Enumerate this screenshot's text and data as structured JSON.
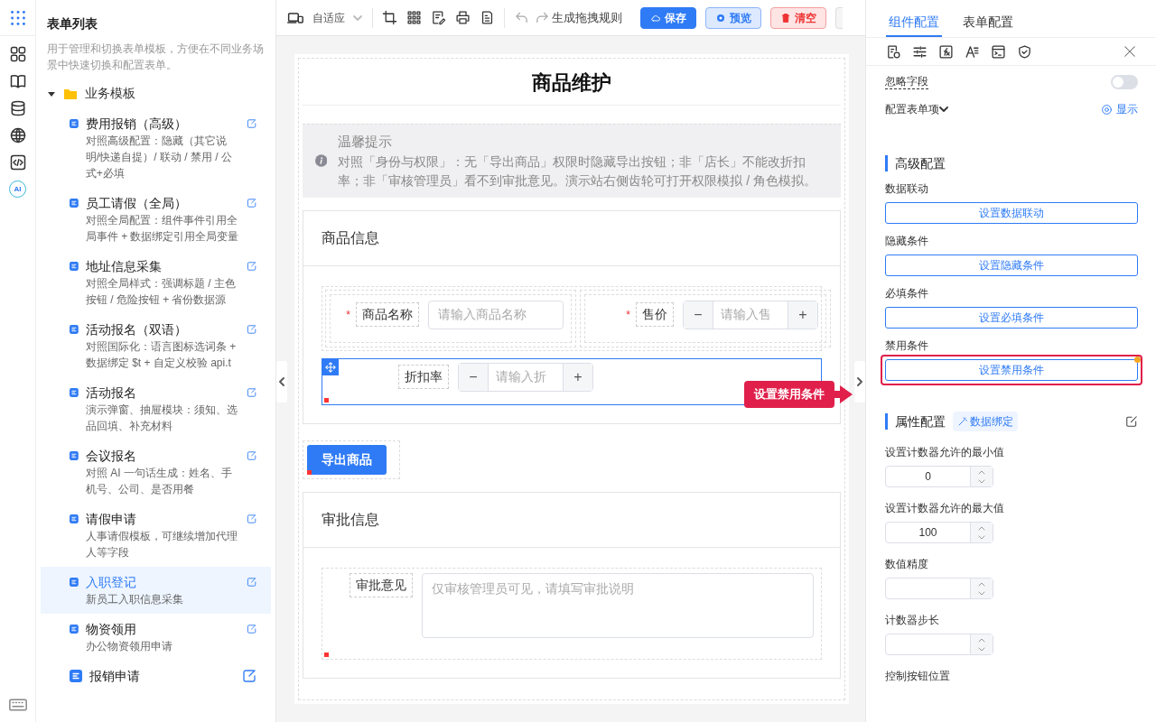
{
  "rail": {
    "ai_label": "AI"
  },
  "sidebar": {
    "title": "表单列表",
    "description": "用于管理和切换表单模板，方便在不同业务场景中快速切换和配置表单。",
    "folder": {
      "label": "业务模板",
      "expanded": true,
      "items": [
        {
          "title": "费用报销（高级）",
          "desc": "对照高级配置：隐藏（其它说明/快递自提）/ 联动 / 禁用 / 公式+必填",
          "selected": false
        },
        {
          "title": "员工请假（全局）",
          "desc": "对照全局配置：组件事件引用全局事件 + 数据绑定引用全局变量",
          "selected": false
        },
        {
          "title": "地址信息采集",
          "desc": "对照全局样式：强调标题 / 主色按钮 / 危险按钮 + 省份数据源",
          "selected": false
        },
        {
          "title": "活动报名（双语）",
          "desc": "对照国际化：语言图标选词条 + 数据绑定 $t + 自定义校验 api.t",
          "selected": false
        },
        {
          "title": "活动报名",
          "desc": "演示弹窗、抽屉模块：须知、选品回填、补充材料",
          "selected": false
        },
        {
          "title": "会议报名",
          "desc": "对照 AI 一句话生成：姓名、手机号、公司、是否用餐",
          "selected": false
        },
        {
          "title": "请假申请",
          "desc": "人事请假模板，可继续增加代理人等字段",
          "selected": false
        },
        {
          "title": "入职登记",
          "desc": "新员工入职信息采集",
          "selected": true
        },
        {
          "title": "物资领用",
          "desc": "办公物资领用申请",
          "selected": false
        },
        {
          "title": "报销申请",
          "selected": false
        }
      ]
    }
  },
  "toolbar": {
    "device": "自适应",
    "rule_link": "生成拖拽规则",
    "buttons": [
      {
        "kind": "save",
        "label": "保存"
      },
      {
        "kind": "preview",
        "label": "预览"
      },
      {
        "kind": "clear",
        "label": "清空"
      }
    ]
  },
  "form": {
    "title": "商品维护",
    "notice": {
      "title": "温馨提示",
      "text": "对照「身份与权限」：无「导出商品」权限时隐藏导出按钮；非「店长」不能改折扣率；非「审核管理员」看不到审批意见。演示站右侧齿轮可打开权限模拟 / 角色模拟。"
    },
    "blocks": [
      {
        "kind": "card",
        "title": "商品信息",
        "rows": [
          [
            {
              "kind": "input",
              "required_mark": "*",
              "label": "商品名称",
              "placeholder": "请输入商品名称",
              "selected": false
            },
            {
              "kind": "stepper",
              "required_mark": "*",
              "label": "售价",
              "minus": "−",
              "placeholder": "请输入售",
              "plus": "+",
              "selected": false
            }
          ],
          [
            {
              "kind": "stepper",
              "label": "折扣率",
              "minus": "−",
              "placeholder": "请输入折",
              "plus": "+",
              "selected": true
            }
          ]
        ]
      },
      {
        "kind": "button",
        "label": "导出商品"
      },
      {
        "kind": "card",
        "title": "审批信息",
        "rows": [
          [
            {
              "kind": "textarea",
              "label": "审批意见",
              "placeholder": "仅审核管理员可见，请填写审批说明",
              "selected": false
            }
          ]
        ]
      }
    ]
  },
  "callout": {
    "text": "设置禁用条件"
  },
  "panel": {
    "tabs": [
      {
        "label": "组件配置",
        "selected": true
      },
      {
        "label": "表单配置",
        "selected": false
      }
    ],
    "ignore_field": {
      "label": "忽略字段",
      "on": false
    },
    "config_items": {
      "label": "配置表单项",
      "toggle": "显示"
    },
    "advanced": {
      "title": "高级配置",
      "rows": [
        {
          "label": "数据联动",
          "button": "设置数据联动",
          "highlighted": false
        },
        {
          "label": "隐藏条件",
          "button": "设置隐藏条件",
          "highlighted": false
        },
        {
          "label": "必填条件",
          "button": "设置必填条件",
          "highlighted": false
        },
        {
          "label": "禁用条件",
          "button": "设置禁用条件",
          "highlighted": true
        }
      ]
    },
    "props": {
      "title": "属性配置",
      "binding": "数据绑定",
      "fields": [
        {
          "kind": "number",
          "label": "设置计数器允许的最小值",
          "value": "0"
        },
        {
          "kind": "number",
          "label": "设置计数器允许的最大值",
          "value": "100"
        },
        {
          "kind": "number",
          "label": "数值精度"
        },
        {
          "kind": "number",
          "label": "计数器步长"
        },
        {
          "kind": "label",
          "label": "控制按钮位置"
        }
      ]
    }
  }
}
